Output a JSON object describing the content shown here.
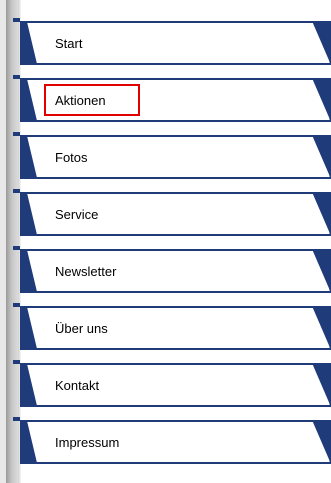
{
  "navigation": {
    "items": [
      {
        "label": "Start"
      },
      {
        "label": "Aktionen",
        "highlighted": true
      },
      {
        "label": "Fotos"
      },
      {
        "label": "Service"
      },
      {
        "label": "Newsletter"
      },
      {
        "label": "Über uns"
      },
      {
        "label": "Kontakt"
      },
      {
        "label": "Impressum"
      }
    ]
  },
  "colors": {
    "tab_border": "#1f3b7a",
    "tab_corner": "#1f3b7a",
    "highlight_box": "#e00000",
    "rail": "#c4c4c4"
  }
}
